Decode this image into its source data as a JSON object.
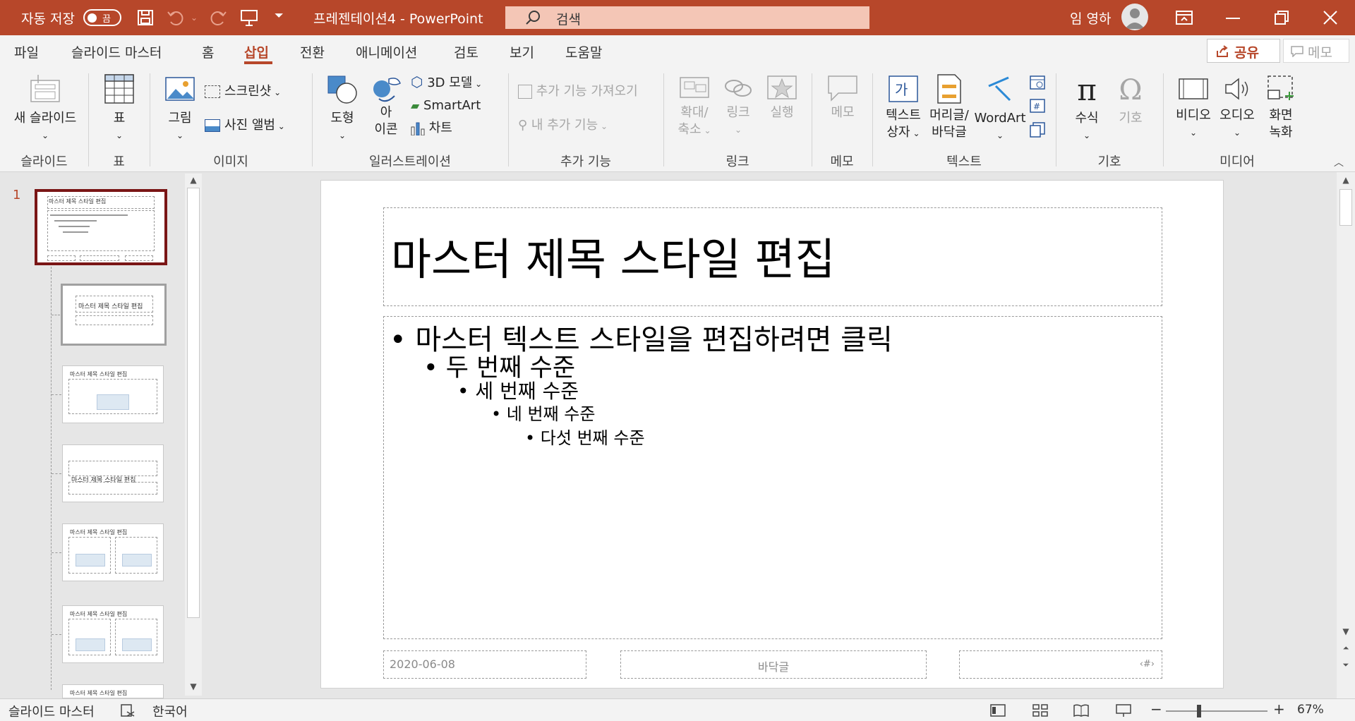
{
  "titlebar": {
    "autosave_label": "자동 저장",
    "autosave_state": "끔",
    "doc_title": "프레젠테이션4  -  PowerPoint",
    "search_placeholder": "검색",
    "user_name": "임 영하",
    "accent_color": "#b7472a"
  },
  "tabs": [
    "파일",
    "슬라이드 마스터",
    "홈",
    "삽입",
    "전환",
    "애니메이션",
    "검토",
    "보기",
    "도움말"
  ],
  "active_tab": "삽입",
  "share_label": "공유",
  "memo_label": "메모",
  "ribbon": {
    "new_slide": "새 슬라이드",
    "table": "표",
    "picture": "그림",
    "screenshot": "스크린샷",
    "photo_album": "사진 앨범",
    "shapes": "도형",
    "icons_1": "아",
    "icons_2": "이콘",
    "model3d": "3D 모델",
    "smartart": "SmartArt",
    "chart": "차트",
    "get_addins": "추가 기능 가져오기",
    "my_addins": "내 추가 기능",
    "zoom_1": "확대/",
    "zoom_2": "축소",
    "link": "링크",
    "action": "실행",
    "comment": "메모",
    "textbox_1": "텍스트",
    "textbox_2": "상자",
    "header_1": "머리글/",
    "header_2": "바닥글",
    "wordart": "WordArt",
    "equation": "수식",
    "symbol": "기호",
    "video": "비디오",
    "audio": "오디오",
    "screen_rec_1": "화면",
    "screen_rec_2": "녹화",
    "groups": {
      "slides": "슬라이드",
      "tables": "표",
      "images": "이미지",
      "illustrations": "일러스트레이션",
      "addins": "추가 기능",
      "links": "링크",
      "comments": "메모",
      "text": "텍스트",
      "symbols": "기호",
      "media": "미디어"
    }
  },
  "thumbnails": {
    "slide_number": "1",
    "master_title": "마스터 제목 스타일 편집"
  },
  "slide": {
    "title": "마스터 제목 스타일 편집",
    "bullets": [
      "마스터 텍스트 스타일을 편집하려면 클릭",
      "두 번째 수준",
      "세 번째 수준",
      "네 번째 수준",
      "다섯 번째 수준"
    ],
    "date": "2020-06-08",
    "footer": "바닥글",
    "page_num": "‹#›"
  },
  "status": {
    "view_label": "슬라이드 마스터",
    "language": "한국어",
    "zoom": "67%"
  }
}
